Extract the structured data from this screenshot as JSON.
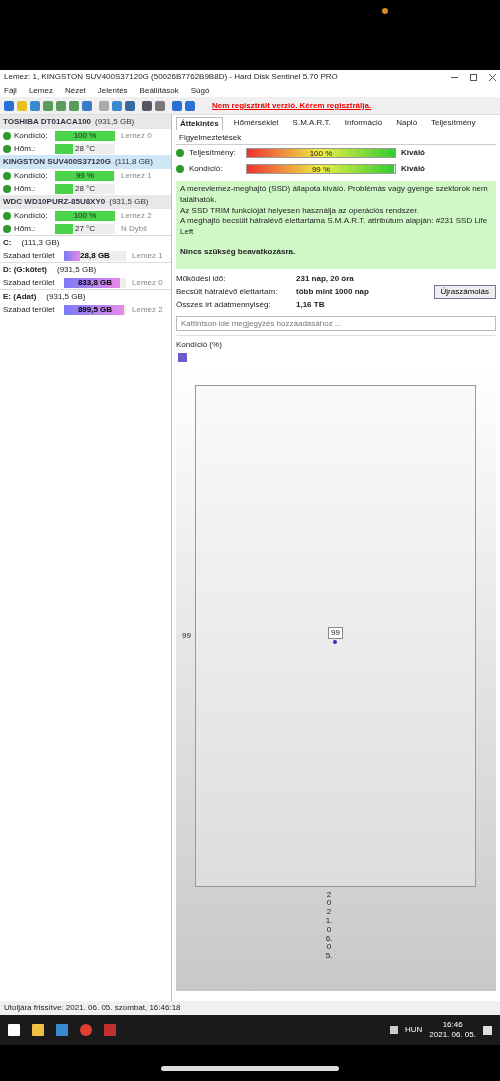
{
  "window": {
    "title": "Lemez: 1, KINGSTON SUV400S37120G (50026B7762B9B8D) - Hard Disk Sentinel 5.70 PRO",
    "menu": [
      "Fájl",
      "Lemez",
      "Nézet",
      "Jelentés",
      "Beállítások",
      "Súgó"
    ],
    "register_notice": "Nem regisztrált verzió. Kérem regisztrálja."
  },
  "disks": [
    {
      "name": "TOSHIBA DT01ACA100",
      "size": "(931,5 GB)",
      "selected": false,
      "rows": [
        {
          "label": "Kondíció:",
          "value": "100 %",
          "level": 1,
          "extra": "Lemez 0"
        },
        {
          "label": "Hőm.:",
          "value": "28 °C",
          "level": 0.3,
          "extra": ""
        }
      ]
    },
    {
      "name": "KINGSTON SUV400S37120G",
      "size": "(111,8 GB)",
      "selected": true,
      "rows": [
        {
          "label": "Kondíció:",
          "value": "99 %",
          "level": 0.99,
          "extra": "Lemez 1"
        },
        {
          "label": "Hőm.:",
          "value": "28 °C",
          "level": 0.3,
          "extra": ""
        }
      ]
    },
    {
      "name": "WDC WD10PURZ-85U8XY0",
      "size": "(931,5 GB)",
      "selected": false,
      "rows": [
        {
          "label": "Kondíció:",
          "value": "100 %",
          "level": 1,
          "extra": "Lemez 2"
        },
        {
          "label": "Hőm.:",
          "value": "27 °C",
          "level": 0.3,
          "extra": "N Dybil"
        }
      ]
    }
  ],
  "volumes": [
    {
      "name": "C:",
      "size": "(111,3 GB)",
      "label": "Szabad terület",
      "value": "28,8 GB",
      "level": 0.26,
      "extra": "Lemez 1"
    },
    {
      "name": "D: (G:kötet)",
      "size": "(931,5 GB)",
      "label": "Szabad terület",
      "value": "833,8 GB",
      "level": 0.9,
      "extra": "Lemez 0"
    },
    {
      "name": "E: (Adat)",
      "size": "(931,5 GB)",
      "label": "Szabad terület",
      "value": "899,5 GB",
      "level": 0.97,
      "extra": "Lemez 2"
    }
  ],
  "tabs": [
    {
      "label": "Áttekintés",
      "selected": true
    },
    {
      "label": "Hőmérséklet",
      "selected": false
    },
    {
      "label": "S.M.A.R.T.",
      "selected": false
    },
    {
      "label": "Információ",
      "selected": false
    },
    {
      "label": "Napló",
      "selected": false
    },
    {
      "label": "Teljesítmény",
      "selected": false
    },
    {
      "label": "Figyelmeztetések",
      "selected": false
    }
  ],
  "meters": [
    {
      "label": "Teljesítmény:",
      "value": "100 %",
      "level": 1,
      "rating": "Kiváló"
    },
    {
      "label": "Kondíció:",
      "value": "99 %",
      "level": 0.99,
      "rating": "Kiváló"
    }
  ],
  "summary": {
    "lines": [
      "A merevlemez-meghajtó (SSD) állapota kiváló. Problémás vagy gyenge szektorok nem találhatók.",
      "Az SSD TRIM funkcióját helyesen használja az operációs rendszer.",
      "A meghajtó becsült hátralévő élettartama S.M.A.R.T. attribútum alapján: #231 SSD Life Left"
    ],
    "note": "Nincs szükség beavatkozásra."
  },
  "info": [
    {
      "label": "Működési idő:",
      "value": "231 nap, 20 óra"
    },
    {
      "label": "Becsült hátralévő élettartam:",
      "value": "több mint 1000 nap"
    },
    {
      "label": "Összes írt adatmennyiség:",
      "value": "1,16 TB"
    }
  ],
  "recalc_button": "Újraszámolás",
  "note_field": {
    "placeholder": "Kattintson ide megjegyzés hozzáadásához ..."
  },
  "chart": {
    "title": "Kondíció (%)",
    "y_axis_label": "99",
    "point_label": "99",
    "date_label": "2021. 06. 05."
  },
  "status_bar": "Utoljára frissítve: 2021. 06. 05. szombat, 16:46:18",
  "taskbar": {
    "language": "HUN",
    "time": "16:46",
    "date": "2021. 06. 05."
  }
}
